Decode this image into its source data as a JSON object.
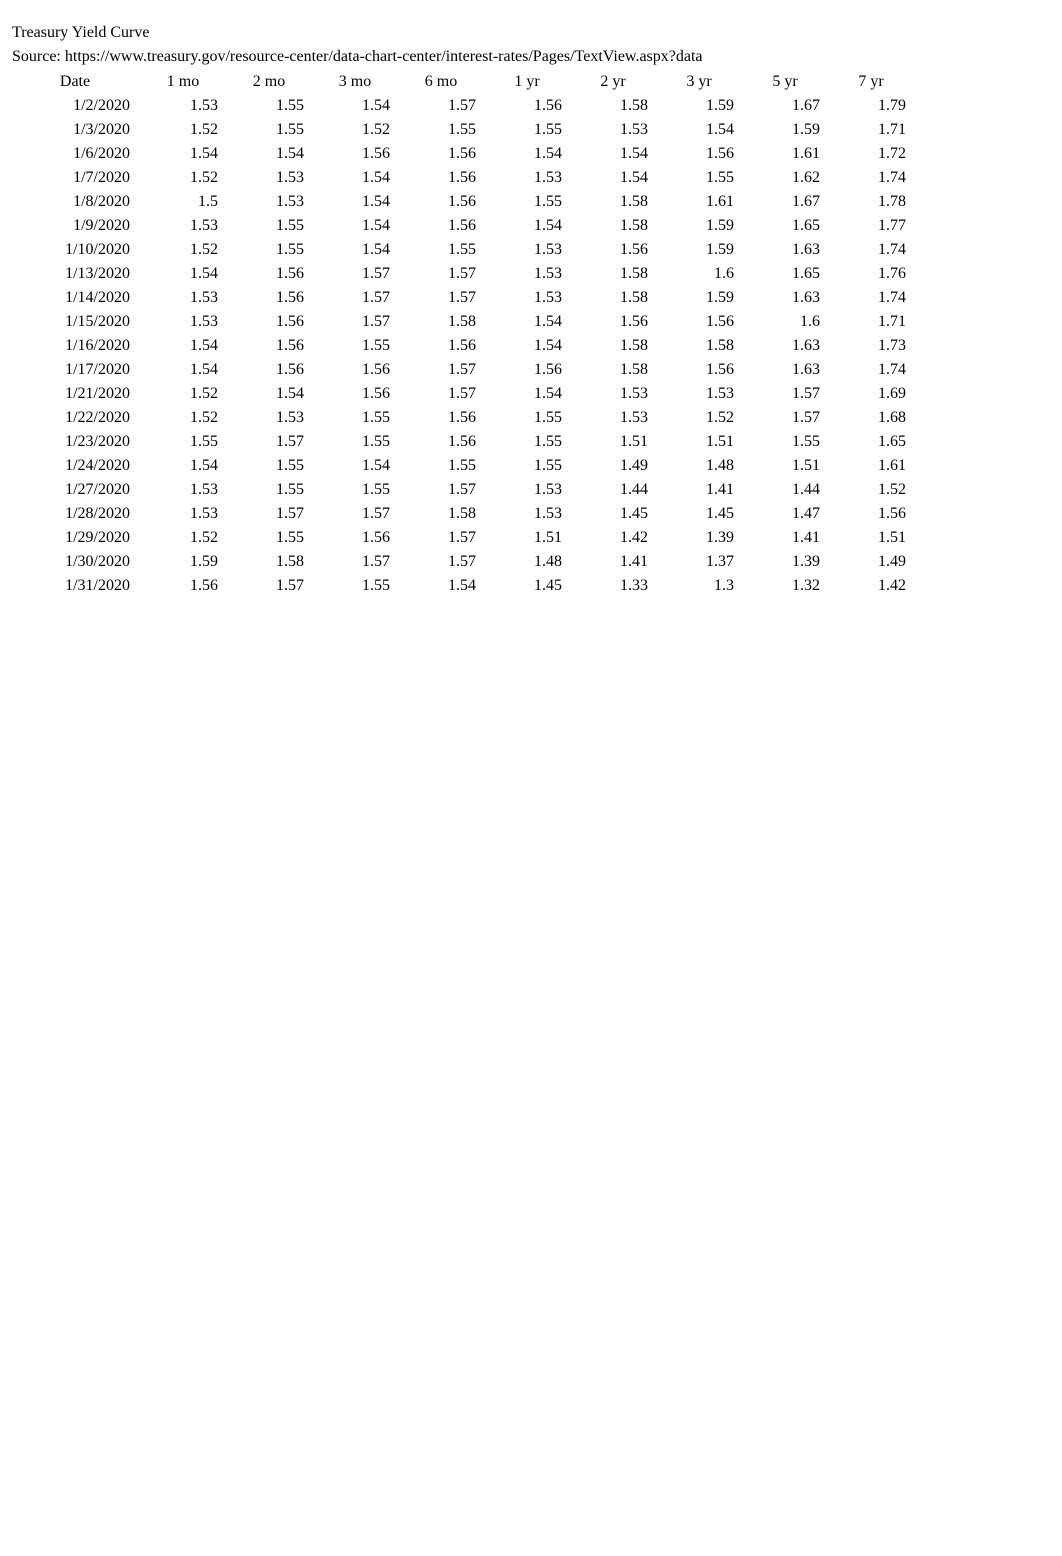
{
  "title": "Treasury Yield Curve",
  "source": "Source: https://www.treasury.gov/resource-center/data-chart-center/interest-rates/Pages/TextView.aspx?data",
  "chart_data": {
    "type": "table",
    "columns": [
      "Date",
      "1 mo",
      "2 mo",
      "3 mo",
      "6 mo",
      "1 yr",
      "2 yr",
      "3 yr",
      "5 yr",
      "7 yr"
    ],
    "rows": [
      [
        "1/2/2020",
        "1.53",
        "1.55",
        "1.54",
        "1.57",
        "1.56",
        "1.58",
        "1.59",
        "1.67",
        "1.79"
      ],
      [
        "1/3/2020",
        "1.52",
        "1.55",
        "1.52",
        "1.55",
        "1.55",
        "1.53",
        "1.54",
        "1.59",
        "1.71"
      ],
      [
        "1/6/2020",
        "1.54",
        "1.54",
        "1.56",
        "1.56",
        "1.54",
        "1.54",
        "1.56",
        "1.61",
        "1.72"
      ],
      [
        "1/7/2020",
        "1.52",
        "1.53",
        "1.54",
        "1.56",
        "1.53",
        "1.54",
        "1.55",
        "1.62",
        "1.74"
      ],
      [
        "1/8/2020",
        "1.5",
        "1.53",
        "1.54",
        "1.56",
        "1.55",
        "1.58",
        "1.61",
        "1.67",
        "1.78"
      ],
      [
        "1/9/2020",
        "1.53",
        "1.55",
        "1.54",
        "1.56",
        "1.54",
        "1.58",
        "1.59",
        "1.65",
        "1.77"
      ],
      [
        "1/10/2020",
        "1.52",
        "1.55",
        "1.54",
        "1.55",
        "1.53",
        "1.56",
        "1.59",
        "1.63",
        "1.74"
      ],
      [
        "1/13/2020",
        "1.54",
        "1.56",
        "1.57",
        "1.57",
        "1.53",
        "1.58",
        "1.6",
        "1.65",
        "1.76"
      ],
      [
        "1/14/2020",
        "1.53",
        "1.56",
        "1.57",
        "1.57",
        "1.53",
        "1.58",
        "1.59",
        "1.63",
        "1.74"
      ],
      [
        "1/15/2020",
        "1.53",
        "1.56",
        "1.57",
        "1.58",
        "1.54",
        "1.56",
        "1.56",
        "1.6",
        "1.71"
      ],
      [
        "1/16/2020",
        "1.54",
        "1.56",
        "1.55",
        "1.56",
        "1.54",
        "1.58",
        "1.58",
        "1.63",
        "1.73"
      ],
      [
        "1/17/2020",
        "1.54",
        "1.56",
        "1.56",
        "1.57",
        "1.56",
        "1.58",
        "1.56",
        "1.63",
        "1.74"
      ],
      [
        "1/21/2020",
        "1.52",
        "1.54",
        "1.56",
        "1.57",
        "1.54",
        "1.53",
        "1.53",
        "1.57",
        "1.69"
      ],
      [
        "1/22/2020",
        "1.52",
        "1.53",
        "1.55",
        "1.56",
        "1.55",
        "1.53",
        "1.52",
        "1.57",
        "1.68"
      ],
      [
        "1/23/2020",
        "1.55",
        "1.57",
        "1.55",
        "1.56",
        "1.55",
        "1.51",
        "1.51",
        "1.55",
        "1.65"
      ],
      [
        "1/24/2020",
        "1.54",
        "1.55",
        "1.54",
        "1.55",
        "1.55",
        "1.49",
        "1.48",
        "1.51",
        "1.61"
      ],
      [
        "1/27/2020",
        "1.53",
        "1.55",
        "1.55",
        "1.57",
        "1.53",
        "1.44",
        "1.41",
        "1.44",
        "1.52"
      ],
      [
        "1/28/2020",
        "1.53",
        "1.57",
        "1.57",
        "1.58",
        "1.53",
        "1.45",
        "1.45",
        "1.47",
        "1.56"
      ],
      [
        "1/29/2020",
        "1.52",
        "1.55",
        "1.56",
        "1.57",
        "1.51",
        "1.42",
        "1.39",
        "1.41",
        "1.51"
      ],
      [
        "1/30/2020",
        "1.59",
        "1.58",
        "1.57",
        "1.57",
        "1.48",
        "1.41",
        "1.37",
        "1.39",
        "1.49"
      ],
      [
        "1/31/2020",
        "1.56",
        "1.57",
        "1.55",
        "1.54",
        "1.45",
        "1.33",
        "1.3",
        "1.32",
        "1.42"
      ]
    ]
  }
}
